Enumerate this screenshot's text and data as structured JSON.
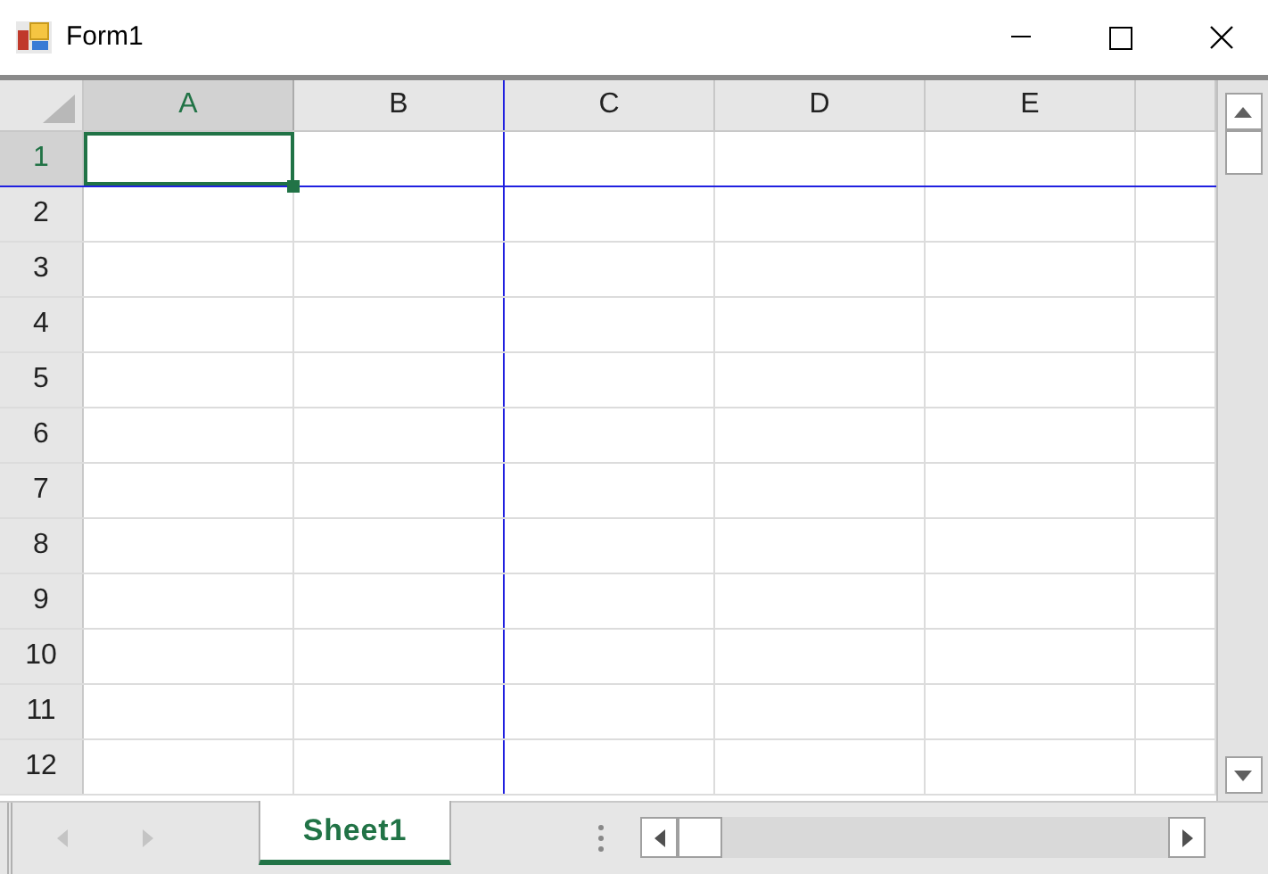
{
  "window": {
    "title": "Form1"
  },
  "columns": [
    {
      "label": "A",
      "selected": true
    },
    {
      "label": "B",
      "selected": false
    },
    {
      "label": "C",
      "selected": false
    },
    {
      "label": "D",
      "selected": false
    },
    {
      "label": "E",
      "selected": false
    }
  ],
  "rows": [
    {
      "label": "1",
      "selected": true
    },
    {
      "label": "2",
      "selected": false
    },
    {
      "label": "3",
      "selected": false
    },
    {
      "label": "4",
      "selected": false
    },
    {
      "label": "5",
      "selected": false
    },
    {
      "label": "6",
      "selected": false
    },
    {
      "label": "7",
      "selected": false
    },
    {
      "label": "8",
      "selected": false
    },
    {
      "label": "9",
      "selected": false
    },
    {
      "label": "10",
      "selected": false
    },
    {
      "label": "11",
      "selected": false
    },
    {
      "label": "12",
      "selected": false
    }
  ],
  "sheet_tabs": [
    {
      "label": "Sheet1",
      "selected": true
    }
  ]
}
